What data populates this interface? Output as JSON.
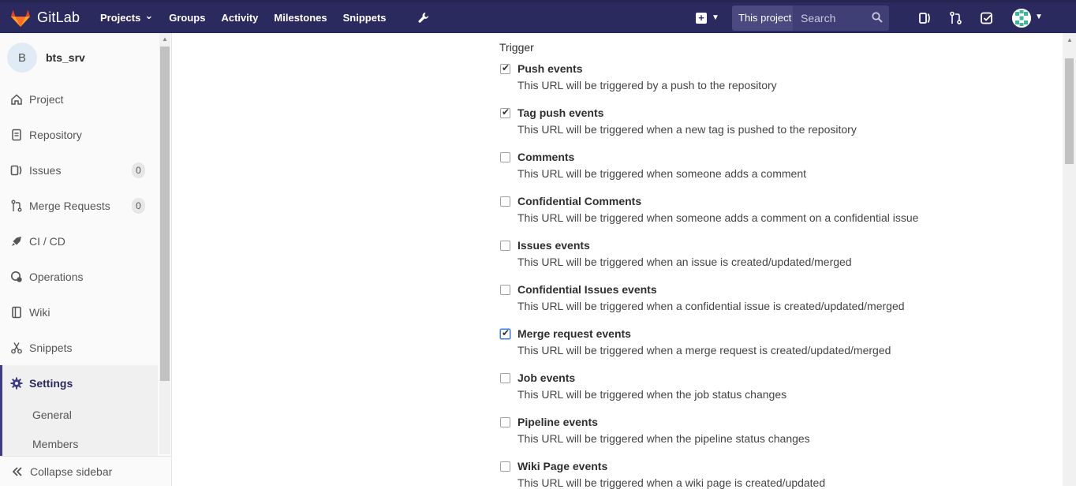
{
  "navbar": {
    "brand": "GitLab",
    "links": [
      {
        "label": "Projects",
        "has_dropdown": true
      },
      {
        "label": "Groups",
        "has_dropdown": false
      },
      {
        "label": "Activity",
        "has_dropdown": false
      },
      {
        "label": "Milestones",
        "has_dropdown": false
      },
      {
        "label": "Snippets",
        "has_dropdown": false
      }
    ],
    "search_scope": "This project",
    "search_placeholder": "Search",
    "colors": {
      "navbar_bg": "#2b2a5e",
      "accent": "#3e3d84"
    }
  },
  "sidebar": {
    "project_initial": "B",
    "project_name": "bts_srv",
    "items": [
      {
        "label": "Project",
        "icon": "home-icon"
      },
      {
        "label": "Repository",
        "icon": "document-icon"
      },
      {
        "label": "Issues",
        "icon": "issues-icon",
        "count": "0"
      },
      {
        "label": "Merge Requests",
        "icon": "merge-request-icon",
        "count": "0"
      },
      {
        "label": "CI / CD",
        "icon": "rocket-icon"
      },
      {
        "label": "Operations",
        "icon": "operations-icon"
      },
      {
        "label": "Wiki",
        "icon": "book-icon"
      },
      {
        "label": "Snippets",
        "icon": "scissors-icon"
      },
      {
        "label": "Settings",
        "icon": "gear-icon",
        "active": true
      }
    ],
    "sub_items": [
      {
        "label": "General"
      },
      {
        "label": "Members"
      }
    ],
    "collapse_label": "Collapse sidebar"
  },
  "main": {
    "trigger_label": "Trigger",
    "triggers": [
      {
        "title": "Push events",
        "desc": "This URL will be triggered by a push to the repository",
        "checked": true
      },
      {
        "title": "Tag push events",
        "desc": "This URL will be triggered when a new tag is pushed to the repository",
        "checked": true
      },
      {
        "title": "Comments",
        "desc": "This URL will be triggered when someone adds a comment",
        "checked": false
      },
      {
        "title": "Confidential Comments",
        "desc": "This URL will be triggered when someone adds a comment on a confidential issue",
        "checked": false
      },
      {
        "title": "Issues events",
        "desc": "This URL will be triggered when an issue is created/updated/merged",
        "checked": false
      },
      {
        "title": "Confidential Issues events",
        "desc": "This URL will be triggered when a confidential issue is created/updated/merged",
        "checked": false
      },
      {
        "title": "Merge request events",
        "desc": "This URL will be triggered when a merge request is created/updated/merged",
        "checked": true,
        "focused": true
      },
      {
        "title": "Job events",
        "desc": "This URL will be triggered when the job status changes",
        "checked": false
      },
      {
        "title": "Pipeline events",
        "desc": "This URL will be triggered when the pipeline status changes",
        "checked": false
      },
      {
        "title": "Wiki Page events",
        "desc": "This URL will be triggered when a wiki page is created/updated",
        "checked": false
      }
    ]
  }
}
